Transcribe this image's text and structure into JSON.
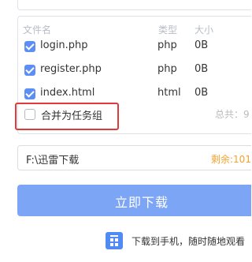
{
  "file_list": {
    "columns": {
      "name": "文件名",
      "type": "类型",
      "size": "大小"
    },
    "rows": [
      {
        "name": "login.php",
        "type": "php",
        "size": "0B",
        "checked": true
      },
      {
        "name": "register.php",
        "type": "php",
        "size": "0B",
        "checked": true
      },
      {
        "name": "index.html",
        "type": "html",
        "size": "0B",
        "checked": true
      }
    ],
    "merge_option": {
      "label": "合并为任务组",
      "checked": false
    },
    "total_label": "总共：9"
  },
  "save_path": {
    "value": "F:\\迅雷下载",
    "remaining": "剩余:101."
  },
  "download_button": {
    "label": "立即下载"
  },
  "mobile_hint": {
    "icon": "qr-phone-icon",
    "text": "下载到手机，随时随地观看"
  },
  "colors": {
    "accent": "#5c8ff3",
    "button": "#7ca5f6",
    "highlight": "#e03a3a",
    "remaining": "#f3a32c",
    "header_text": "#b7bcc6"
  }
}
